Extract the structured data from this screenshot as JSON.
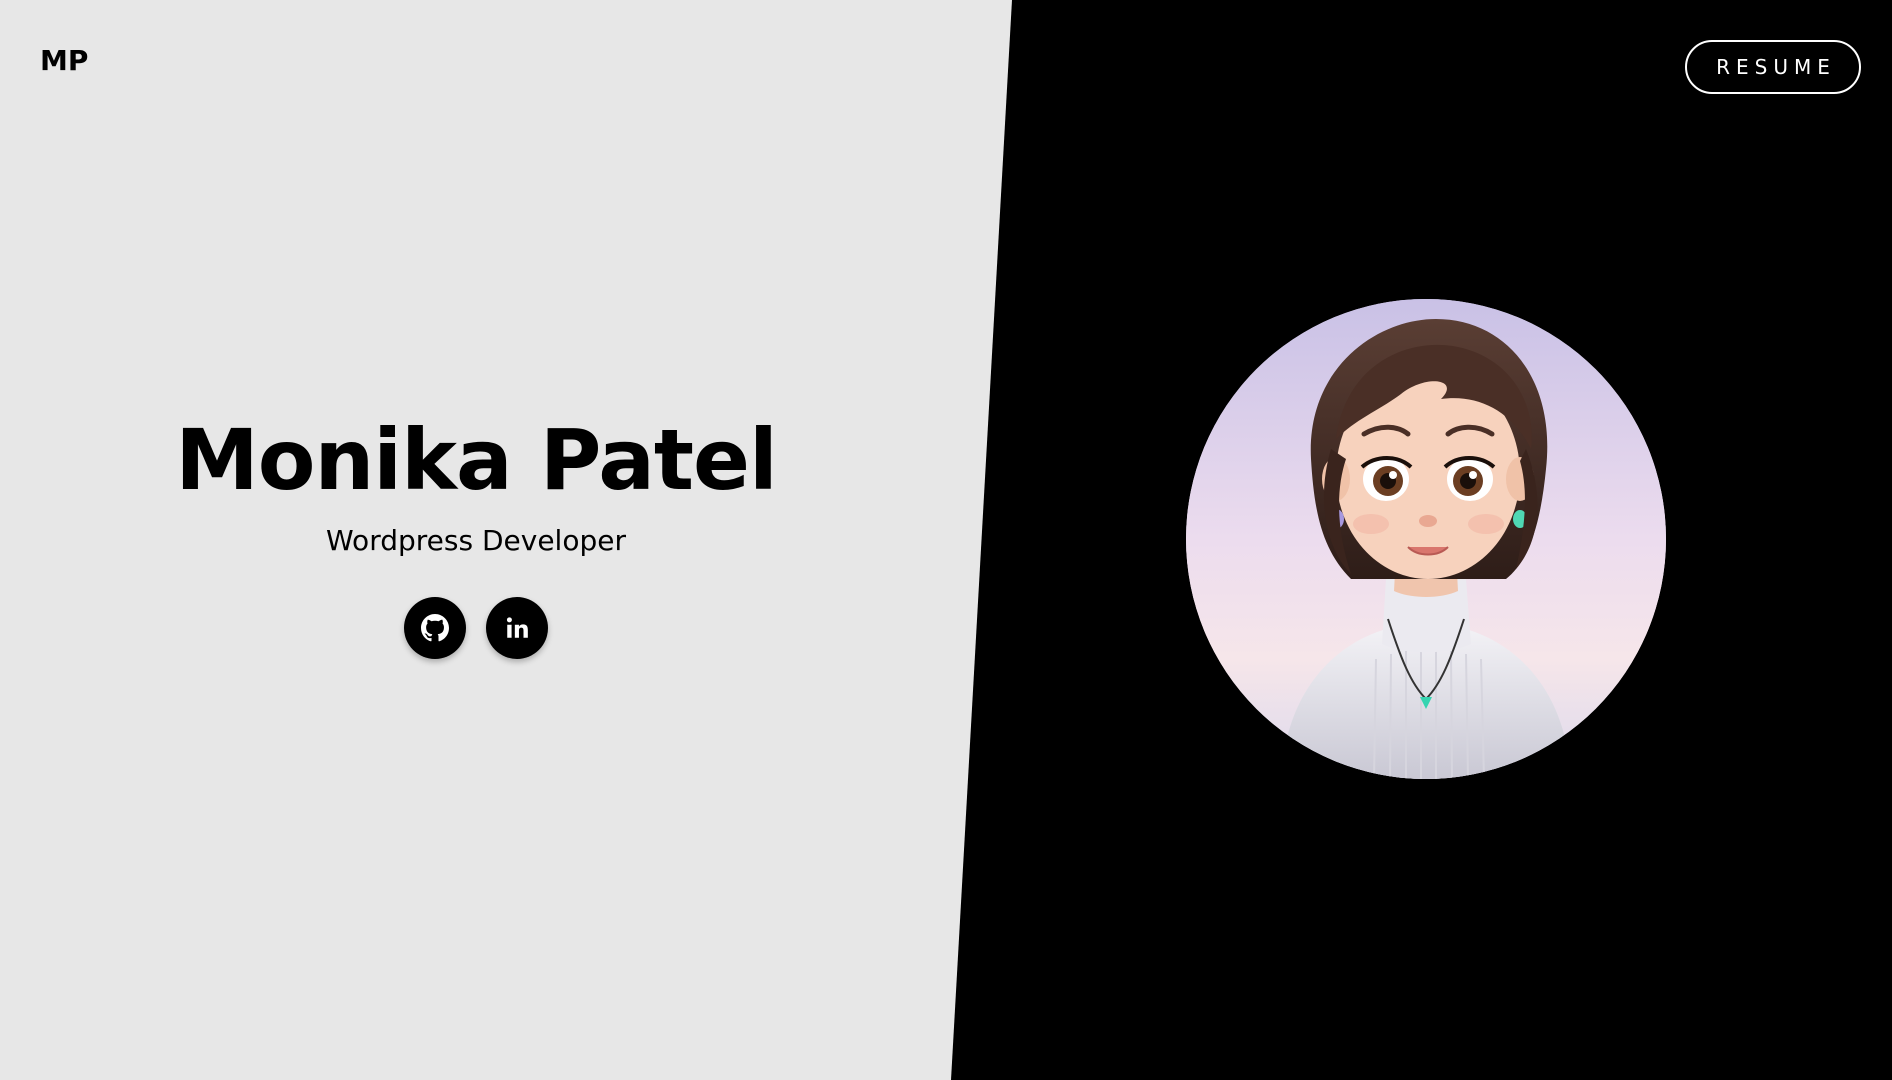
{
  "header": {
    "logo_text": "MP",
    "resume_label": "RESUME"
  },
  "hero": {
    "name": "Monika Patel",
    "role": "Wordpress Developer"
  },
  "socials": [
    {
      "icon": "github-icon"
    },
    {
      "icon": "linkedin-icon"
    }
  ],
  "avatar": {
    "icon": "profile-avatar-illustration"
  },
  "colors": {
    "left_background": "#e7e7e7",
    "right_background": "#000000",
    "text": "#000000",
    "button_outline": "#ffffff"
  }
}
